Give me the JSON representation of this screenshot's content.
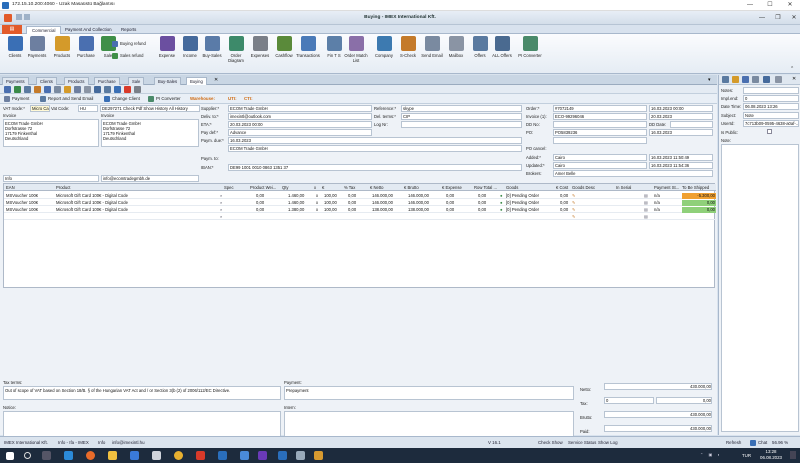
{
  "rdp": {
    "title": "172.15.10.200:4060 - Uzak Masaüstü Bağlantısı"
  },
  "app": {
    "title": "Buying - IMEX International Kft."
  },
  "ribbon": {
    "tabs": [
      "Commercial",
      "Payment And Collection",
      "Reports"
    ],
    "buttons": [
      {
        "label": "Clients",
        "color": "#3a6fb5"
      },
      {
        "label": "Payments",
        "color": "#6d7fa0"
      },
      {
        "label": "Products",
        "color": "#d49a2a"
      },
      {
        "label": "Purchase",
        "color": "#4a6fb0"
      },
      {
        "label": "Sale",
        "color": "#3f8f48"
      },
      {
        "label": "Expense",
        "color": "#6b4fa0"
      },
      {
        "label": "Income",
        "color": "#456a9c"
      },
      {
        "label": "Buy-Sales",
        "color": "#5a7ba8"
      },
      {
        "label": "Order Diagram",
        "color": "#3d8a6a"
      },
      {
        "label": "Expenses",
        "color": "#7a7f88"
      },
      {
        "label": "Cashflow",
        "color": "#5a8a3a"
      },
      {
        "label": "Transactions",
        "color": "#4a7ab8"
      },
      {
        "label": "Fin T S",
        "color": "#5c7fa8"
      },
      {
        "label": "Order Match List",
        "color": "#8a6fa8"
      },
      {
        "label": "Company",
        "color": "#3d7ab0"
      },
      {
        "label": "S-Check",
        "color": "#c47a2a"
      },
      {
        "label": "Send Email",
        "color": "#7a8aa0"
      },
      {
        "label": "Mailbox",
        "color": "#8a94a4"
      },
      {
        "label": "Offers",
        "color": "#5a7aa0"
      },
      {
        "label": "ALL Offers",
        "color": "#4a6a90"
      },
      {
        "label": "PI Converter",
        "color": "#4a8a6a"
      }
    ],
    "small": {
      "buying_refund": "Buying refund",
      "sales_refund": "Sales refund"
    }
  },
  "doctabs": [
    "Payments",
    "Clients",
    "Products",
    "Purchase",
    "Sale",
    "Buy-Sales",
    "Buying"
  ],
  "toolbar2": {
    "payment": "Payment",
    "report_send": "Report and Send Email",
    "change_client": "Change Client",
    "pi_converter": "PI Converter",
    "warehouse_label": "Warehouse:",
    "uti": "UTI:",
    "cti": "CTI:"
  },
  "client": {
    "vat_mode_label": "VAT mode:*",
    "vat_mode": "Micro Car",
    "vat_code_label": "Vat Code:",
    "vat_code": "HU",
    "vat_number": "DE297271  Check Pdf  Show  History  All History",
    "invoice_label": "Invoice",
    "invoice_lines": "ECOM Trade GmbH\nDorfstrasse 72\n17179 Finkenthal\nDeutschland",
    "invoice2_label": "Invoice",
    "invoice2_lines": "ECOM Trade GmbH\nDorfstrasse 72\n17179 Finkenthal\nDeutschland",
    "info_label": "Info",
    "email": "info@ecomtradegmbh.de"
  },
  "supplier": {
    "supplier_label": "Supplier:*",
    "supplier": "ECOM Trade GmbH",
    "deliv_label": "Deliv. to:*",
    "deliv": "imexintl@outlook.com",
    "eta_label": "ETA:*",
    "eta": "20.03.2023 00:00",
    "paydef_label": "Pay def:*",
    "paydef": "Advance",
    "paym_due_label": "Paym. due:*",
    "paym_due": "16.03.2023",
    "paym_to_label": "Paym. to:",
    "paym_to": "ECOM Trade GmbH",
    "iban_label": "IBAN:*",
    "iban": "DE99 1001 0010 0863 1351 37",
    "reference_label": "Reference:*",
    "reference": "skype",
    "del_terms_label": "Del. terms:*",
    "del_terms": "CIP",
    "log_nr_label": "Log Nr:",
    "log_nr": ""
  },
  "order": {
    "order_label": "Order:*",
    "order": "#7072149",
    "order_date": "16.03.2023 00:00",
    "invoice_label": "Invoice (1):",
    "invoice": "ECO-99296046",
    "invoice_date": "20.03.2023",
    "dd_label": "DD No:",
    "dd_date_label": "DD Date:",
    "po_label": "PO:",
    "po": "PO5839236",
    "po_date": "16.03.2023",
    "po_cancel_label": "PO cancel:",
    "added_label": "Added:*",
    "added_by": "Cairo",
    "added_at": "16.03.2023 11:50:49",
    "updated_label": "Updated:*",
    "updated_by": "Cairo",
    "updated_at": "16.03.2023 11:54:36",
    "brokers_label": "Brokers:",
    "brokers": "Amer Belle"
  },
  "grid": {
    "headers": [
      "EAN",
      "Product",
      "Spec",
      "Product Wei...",
      "Qty",
      "x",
      "€",
      "% Tax",
      "€ Netto",
      "€ Brutto",
      "€ Expense",
      "Row Total ...",
      "Goods",
      "€ Cost",
      "Goods Desc",
      "In Serial",
      "Payment St...",
      "To Be Shipped"
    ],
    "rows": [
      {
        "ean": "MSVoucher 100€",
        "product": "Microsoft Gift Card 100€ - Digital Code",
        "weight": "0,00",
        "qty": "1.460,00",
        "x": "x",
        "price": "100,00",
        "tax": "0,00",
        "netto": "146.000,00",
        "brutto": "146.000,00",
        "expense": "0,00",
        "rowtotal": "0,00",
        "goods": "[0] Pending Order",
        "cost": "0,00",
        "payment": "n/a",
        "ship": "-5.300,00",
        "ship_color": "#f0a030"
      },
      {
        "ean": "MSVoucher 100€",
        "product": "Microsoft Gift Card 100€ - Digital Code",
        "weight": "0,00",
        "qty": "1.460,00",
        "x": "x",
        "price": "100,00",
        "tax": "0,00",
        "netto": "146.000,00",
        "brutto": "146.000,00",
        "expense": "0,00",
        "rowtotal": "0,00",
        "goods": "[0] Pending Order",
        "cost": "0,00",
        "payment": "n/a",
        "ship": "0,00",
        "ship_color": "#8fd07a"
      },
      {
        "ean": "MSVoucher 100€",
        "product": "Microsoft Gift Card 100€ - Digital Code",
        "weight": "0,00",
        "qty": "1.380,00",
        "x": "x",
        "price": "100,00",
        "tax": "0,00",
        "netto": "138.000,00",
        "brutto": "138.000,00",
        "expense": "0,00",
        "rowtotal": "0,00",
        "goods": "[0] Pending Order",
        "cost": "0,00",
        "payment": "n/a",
        "ship": "0,00",
        "ship_color": "#8fd07a"
      }
    ]
  },
  "bottom": {
    "tax_terms_label": "Tax terms:",
    "tax_terms": "Out of scope of VAT based on Section 18/B. § of the Hungarian VAT Act and / or Section 3(b (2) of 2006/112/EC Directive.",
    "payment_label": "Payment:",
    "payment": "Prepayment",
    "notice_label": "Notice:",
    "intern_label": "Intern:",
    "netto_label": "Netto:",
    "netto": "430.000,00",
    "tax_label": "Tax:",
    "tax1": "0",
    "tax2": "0,00",
    "brutto_label": "Brutto:",
    "brutto": "430.000,00",
    "paid_label": "Paid:",
    "paid": "430.000,00"
  },
  "rpanel": {
    "notes_label": "Notes:",
    "notes": "",
    "impl_label": "Impl.end:",
    "impl": "0",
    "date_label": "Date Time:",
    "date": "06.08.2023 13:26",
    "subject_label": "Subject:",
    "subject": "Note",
    "userid_label": "UserId:",
    "userid": "7c713b09-0595-4638-a0af-...",
    "ispublic_label": "Is Public:",
    "note_label": "Note:"
  },
  "status": {
    "company": "IMEX International Kft.",
    "info1": "Info - Ifa - IMEX",
    "info2": "Info",
    "email": "info@imexintl.hu",
    "version": "V 16.1",
    "check_show": "Check Show",
    "service_status": "Service Status",
    "show_log": "Show Log",
    "refresh": "Refresh",
    "chat": "Chat",
    "chat_count": "56.96 %"
  },
  "taskbar": {
    "lang": "TUR",
    "time": "13:28",
    "date": "06.08.2023"
  }
}
